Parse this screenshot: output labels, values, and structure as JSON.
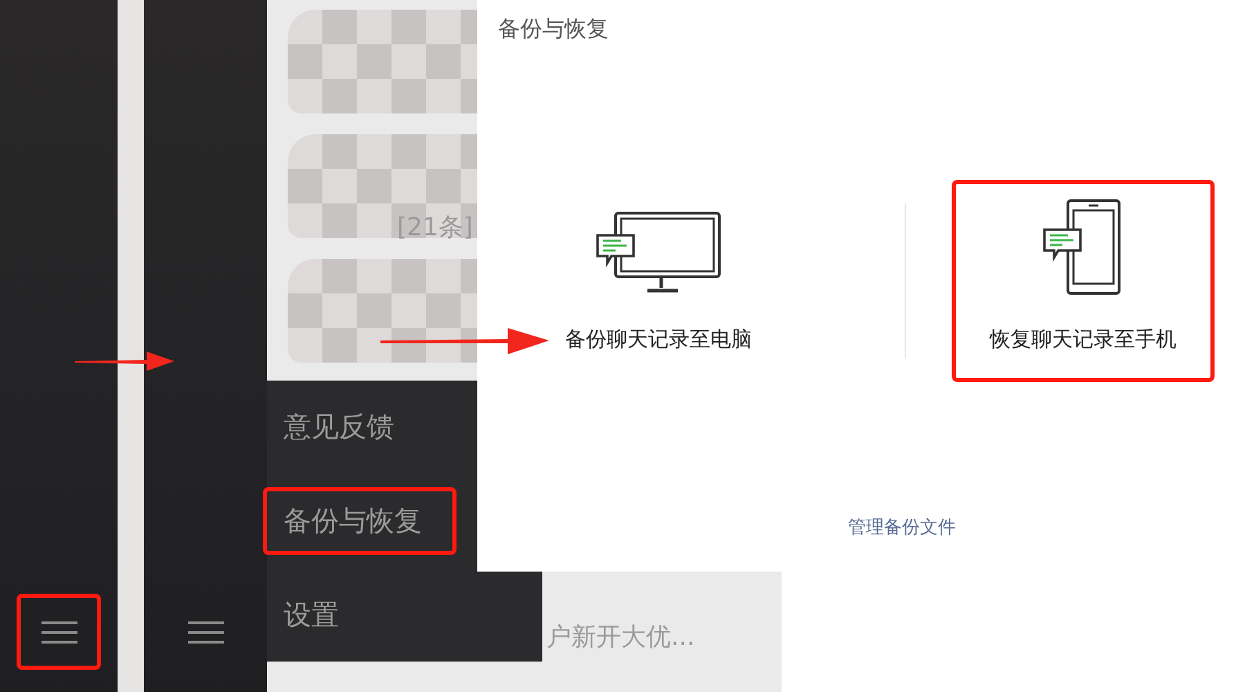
{
  "sidebars": [
    {
      "menu_highlighted": true
    },
    {
      "menu_highlighted": false
    }
  ],
  "chat_list": {
    "items": [
      {
        "pixelated": true
      },
      {
        "pixelated": true,
        "preview": "[21条]"
      },
      {
        "pixelated": true
      },
      {
        "pixelated": false,
        "preview": "户新开大优..."
      }
    ]
  },
  "menu": {
    "items": [
      {
        "label": "意见反馈",
        "highlighted": false
      },
      {
        "label": "备份与恢复",
        "highlighted": true
      },
      {
        "label": "设置",
        "highlighted": false
      }
    ]
  },
  "dialog": {
    "title": "备份与恢复",
    "options": [
      {
        "kind": "computer",
        "label": "备份聊天记录至电脑",
        "highlighted": false
      },
      {
        "kind": "phone",
        "label": "恢复聊天记录至手机",
        "highlighted": true
      }
    ],
    "link": "管理备份文件"
  }
}
